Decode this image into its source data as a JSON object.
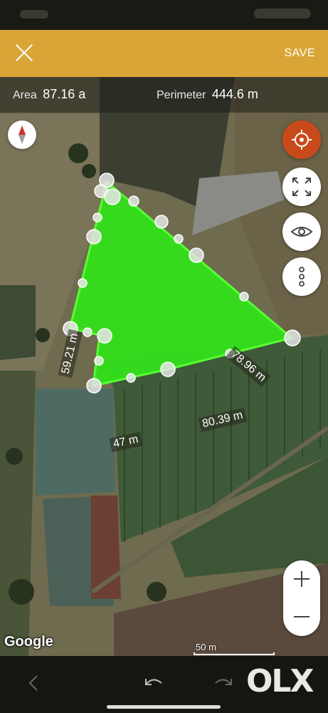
{
  "toolbar": {
    "save_label": "SAVE",
    "close_icon": "close-icon",
    "background": "#d9a536"
  },
  "stats": {
    "area_label": "Area",
    "area_value": "87.16 a",
    "perimeter_label": "Perimeter",
    "perimeter_value": "444.6 m"
  },
  "polygon": {
    "fill": "#33e01a",
    "edges": [
      "59.21 m",
      "78.96 m",
      "80.39 m",
      "47 m"
    ]
  },
  "map_controls": {
    "compass_icon": "compass-icon",
    "locate_icon": "crosshair-icon",
    "locate_color": "#c84a1a",
    "fullscreen_icon": "fullscreen-icon",
    "eye_icon": "eye-icon",
    "more_icon": "more-vertical-icon",
    "zoom_in_icon": "plus-icon",
    "zoom_out_icon": "minus-icon"
  },
  "attribution": "Google",
  "scale": "50 m",
  "bottom_nav": {
    "back_icon": "chevron-left-icon",
    "undo_icon": "undo-icon",
    "redo_icon": "redo-icon"
  },
  "watermark": "OLX"
}
